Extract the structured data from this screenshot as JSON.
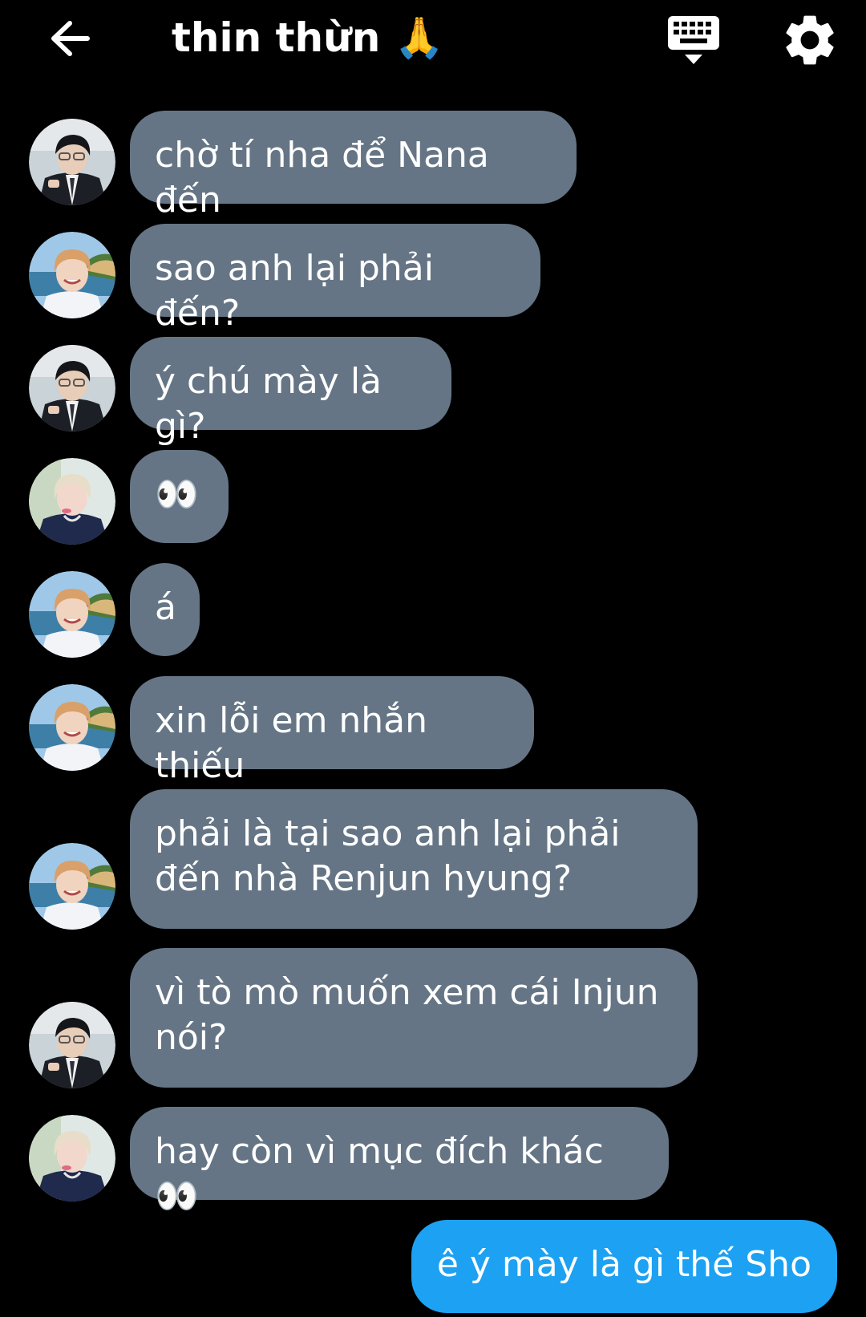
{
  "header": {
    "title": "thin thừn 🙏",
    "back_icon": "arrow-left-icon",
    "keyboard_icon": "keyboard-icon",
    "settings_icon": "gear-icon"
  },
  "colors": {
    "background": "#000000",
    "incoming_bubble": "#657585",
    "outgoing_bubble": "#1DA1F2"
  },
  "messages": [
    {
      "direction": "incoming",
      "sender_avatar": "avatar-dark-hair-suit",
      "text": "chờ tí nha để Nana đến"
    },
    {
      "direction": "incoming",
      "sender_avatar": "avatar-orange-hair-beach",
      "text": "sao anh lại phải đến?"
    },
    {
      "direction": "incoming",
      "sender_avatar": "avatar-dark-hair-suit",
      "text": "ý chú mày là gì?"
    },
    {
      "direction": "incoming",
      "sender_avatar": "avatar-blonde-hair-navy",
      "text": "👀"
    },
    {
      "direction": "incoming",
      "sender_avatar": "avatar-orange-hair-beach",
      "text": "á"
    },
    {
      "direction": "incoming",
      "sender_avatar": "avatar-orange-hair-beach",
      "text": "xin lỗi em nhắn thiếu"
    },
    {
      "direction": "incoming",
      "sender_avatar": "avatar-orange-hair-beach",
      "text": "phải là tại sao anh lại phải đến nhà Renjun hyung?"
    },
    {
      "direction": "incoming",
      "sender_avatar": "avatar-dark-hair-suit",
      "text": "vì tò mò muốn xem cái Injun nói?"
    },
    {
      "direction": "incoming",
      "sender_avatar": "avatar-blonde-hair-navy",
      "text": "hay còn vì mục đích khác 👀"
    },
    {
      "direction": "outgoing",
      "text": "ê ý mày là gì thế Sho"
    }
  ]
}
